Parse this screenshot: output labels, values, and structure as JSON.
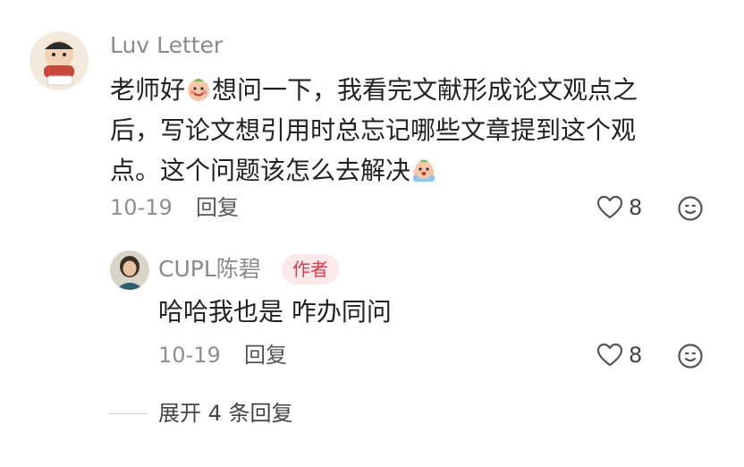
{
  "comment": {
    "username": "Luv Letter",
    "text_lines": [
      [
        "老师好",
        "想问一下，我看完文献形成论文观点之"
      ],
      "后，写论文想引用时总忘记哪些文章提到这个观",
      [
        "点。这个问题该怎么去解决",
        ""
      ]
    ],
    "date": "10-19",
    "reply_label": "回复",
    "like_count": "8"
  },
  "reply": {
    "username": "CUPL陈碧",
    "badge": "作者",
    "text": "哈哈我也是 咋办同问",
    "date": "10-19",
    "reply_label": "回复",
    "like_count": "8"
  },
  "expand": {
    "label": "展开 4 条回复"
  },
  "icons": {
    "heart": "heart-icon",
    "emoji_reaction": "smile-icon"
  },
  "colors": {
    "badge_bg": "#fde8ea",
    "badge_text": "#e0384d",
    "muted": "#8f8f8f"
  }
}
